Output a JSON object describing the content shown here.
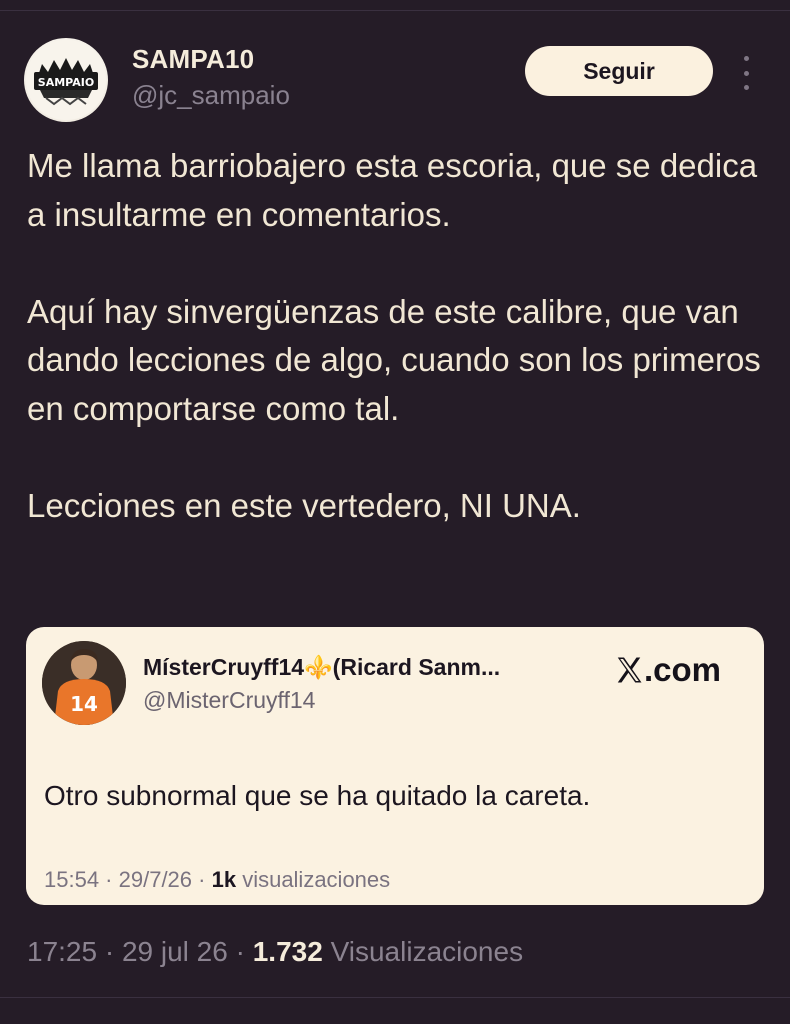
{
  "author": {
    "name": "SAMPA10",
    "handle": "@jc_sampaio",
    "avatar_logo_text": "SAMPAIO"
  },
  "actions": {
    "follow_label": "Seguir"
  },
  "tweet": {
    "paragraph_1": "Me llama barriobajero esta escoria, que se dedica a insultarme en comentarios.",
    "paragraph_2": "Aquí hay sinvergüenzas de este calibre, que van dando lecciones de algo, cuando son los primeros en comportarse como tal.",
    "paragraph_3": "Lecciones en este vertedero, NI UNA."
  },
  "quote": {
    "name": "MísterCruyff14⚜️(Ricard Sanm...",
    "handle": "@MisterCruyff14",
    "source": ".com",
    "text": "Otro subnormal que se ha quitado la careta.",
    "time": "15:54",
    "sep1": " · ",
    "date": "29/7/26",
    "sep2": " · ",
    "views_count": "1k",
    "views_label": " visualizaciones",
    "jersey_number": "14"
  },
  "meta": {
    "time": "17:25",
    "sep1": " · ",
    "date": "29 jul 26",
    "sep2": " · ",
    "views_count": "1.732",
    "views_label": " Visualizaciones"
  },
  "colors": {
    "background": "#251c27",
    "card_background": "#fbf2e1",
    "button_background": "#fbf1df",
    "text_primary": "#f1e7d4",
    "text_muted": "#8a8290"
  }
}
